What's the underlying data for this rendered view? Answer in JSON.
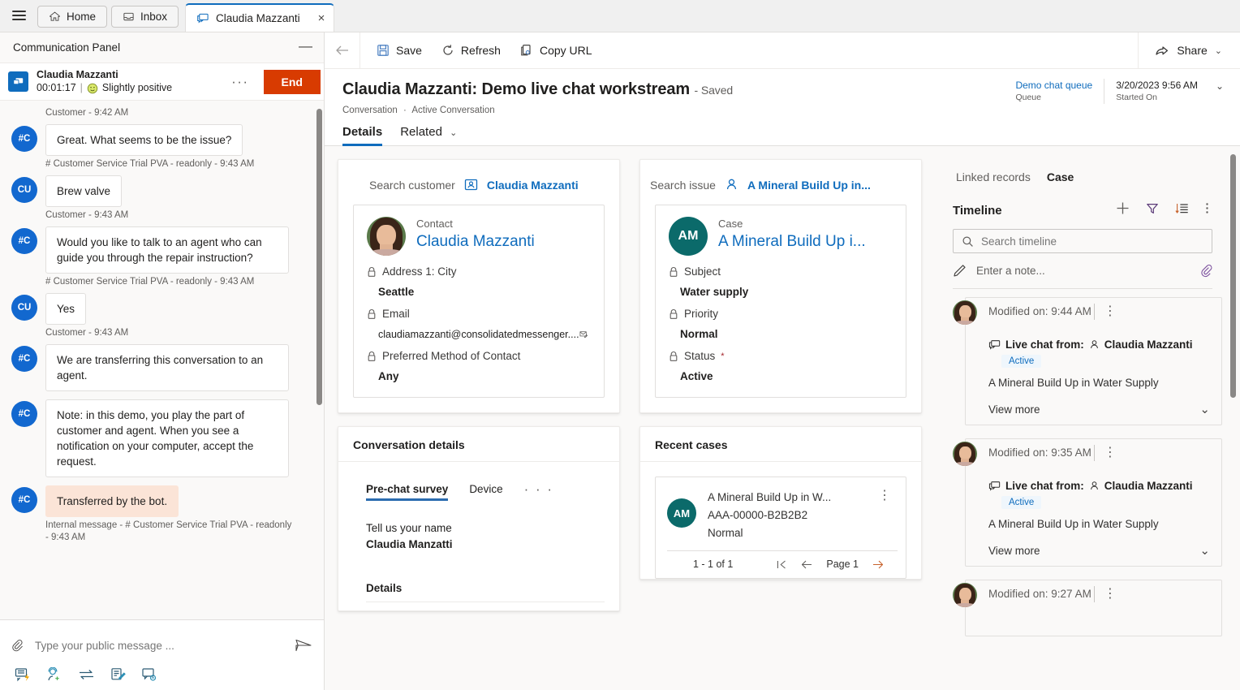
{
  "tabstrip": {
    "menu_icon": "hamburger-icon",
    "tabs": [
      {
        "label": "Home",
        "icon": "home-icon"
      },
      {
        "label": "Inbox",
        "icon": "inbox-icon"
      }
    ],
    "active_tab": {
      "label": "Claudia Mazzanti",
      "icon": "chat-icon",
      "close": "×"
    }
  },
  "communication_panel": {
    "title": "Communication Panel",
    "minimize": "—",
    "conversation": {
      "name": "Claudia Mazzanti",
      "timer": "00:01:17",
      "separator": "|",
      "sentiment": "Slightly positive",
      "sentiment_icon": "smiley-icon",
      "more": "···",
      "end_label": "End"
    },
    "messages": [
      {
        "type": "stamp",
        "text": "Customer - 9:42 AM"
      },
      {
        "type": "msg",
        "initials": "#C",
        "text": "Great. What seems to be the issue?",
        "stamp": "# Customer Service Trial PVA - readonly - 9:43 AM",
        "variant": "normal"
      },
      {
        "type": "msg",
        "initials": "CU",
        "text": "Brew valve",
        "stamp": "Customer - 9:43 AM",
        "variant": "normal"
      },
      {
        "type": "msg",
        "initials": "#C",
        "text": "Would you like to talk to an agent who can guide you through the repair instruction?",
        "stamp": "# Customer Service Trial PVA - readonly - 9:43 AM",
        "variant": "normal"
      },
      {
        "type": "msg",
        "initials": "CU",
        "text": "Yes",
        "stamp": "Customer - 9:43 AM",
        "variant": "normal"
      },
      {
        "type": "msg",
        "initials": "#C",
        "text": "We are transferring this conversation to an agent.",
        "stamp": "",
        "variant": "normal"
      },
      {
        "type": "msg",
        "initials": "#C",
        "text": "Note: in this demo, you play the part of customer and agent. When you see a notification on your computer, accept the request.",
        "stamp": "",
        "variant": "normal"
      },
      {
        "type": "msg",
        "initials": "#C",
        "text": "Transferred by the bot.",
        "stamp": "Internal message - # Customer Service Trial PVA - readonly - 9:43 AM",
        "variant": "internal"
      }
    ],
    "composer": {
      "attach_icon": "paperclip-icon",
      "placeholder": "Type your public message ...",
      "send_icon": "send-icon"
    },
    "tools": [
      {
        "icon": "quick-replies-icon"
      },
      {
        "icon": "consult-agent-icon"
      },
      {
        "icon": "transfer-icon"
      },
      {
        "icon": "notes-icon"
      },
      {
        "icon": "linked-conversation-icon"
      }
    ]
  },
  "command_bar": {
    "back_icon": "back-arrow-icon",
    "commands": [
      {
        "label": "Save",
        "icon": "save-icon"
      },
      {
        "label": "Refresh",
        "icon": "refresh-icon"
      },
      {
        "label": "Copy URL",
        "icon": "copy-url-icon"
      }
    ],
    "share": {
      "label": "Share",
      "icon": "share-icon",
      "chevron": "⌄"
    }
  },
  "record_header": {
    "title": "Claudia Mazzanti: Demo live chat workstream",
    "saved": "- Saved",
    "breadcrumb_entity": "Conversation",
    "breadcrumb_sep": "·",
    "breadcrumb_view": "Active Conversation",
    "queue_value": "Demo chat queue",
    "queue_label": "Queue",
    "started_value": "3/20/2023 9:56 AM",
    "started_label": "Started On",
    "expand_chevron": "⌄"
  },
  "form_tabs": [
    {
      "label": "Details",
      "selected": true
    },
    {
      "label": "Related",
      "selected": false,
      "chevron": "⌄"
    }
  ],
  "customer_section": {
    "search_label": "Search customer",
    "search_value": "Claudia Mazzanti",
    "search_icon": "contact-card-icon",
    "card": {
      "type": "Contact",
      "name": "Claudia Mazzanti",
      "avatar": "contact-photo",
      "fields": [
        {
          "label": "Address 1: City",
          "value": "Seattle",
          "lock": "lock-icon",
          "trailing_icon": ""
        },
        {
          "label": "Email",
          "value": "claudiamazzanti@consolidatedmessenger....",
          "lock": "lock-icon",
          "trailing_icon": "email-icon",
          "small": true
        },
        {
          "label": "Preferred Method of Contact",
          "value": "Any",
          "lock": "lock-icon",
          "trailing_icon": ""
        }
      ]
    }
  },
  "issue_section": {
    "search_label": "Search issue",
    "search_value": "A Mineral Build Up in...",
    "search_icon": "person-icon",
    "card": {
      "type": "Case",
      "name": "A Mineral Build Up i...",
      "initials": "AM",
      "avatar_color": "#0b6a6a",
      "fields": [
        {
          "label": "Subject",
          "value": "Water supply",
          "lock": "lock-icon",
          "required": false
        },
        {
          "label": "Priority",
          "value": "Normal",
          "lock": "lock-icon",
          "required": false
        },
        {
          "label": "Status",
          "value": "Active",
          "lock": "lock-icon",
          "required": true,
          "required_mark": "*"
        }
      ]
    }
  },
  "conversation_details": {
    "title": "Conversation details",
    "tabs": [
      {
        "label": "Pre-chat survey",
        "selected": true
      },
      {
        "label": "Device",
        "selected": false
      },
      {
        "label": "· · ·",
        "selected": false,
        "is_dots": true
      }
    ],
    "survey_question": "Tell us your name",
    "survey_answer": "Claudia Manzatti",
    "details_heading": "Details"
  },
  "recent_cases": {
    "title": "Recent cases",
    "items": [
      {
        "initials": "AM",
        "title": "A Mineral Build Up in W...",
        "number": "AAA-00000-B2B2B2",
        "priority": "Normal",
        "more": "⋮"
      }
    ],
    "pager": {
      "count": "1 - 1 of 1",
      "first_icon": "first-page-icon",
      "prev_icon": "prev-page-icon",
      "page_label": "Page 1",
      "next_icon": "next-page-icon"
    }
  },
  "linked_records": {
    "label": "Linked records",
    "value": "Case"
  },
  "timeline": {
    "title": "Timeline",
    "actions": [
      {
        "icon": "plus-icon"
      },
      {
        "icon": "filter-icon"
      },
      {
        "icon": "sort-icon"
      },
      {
        "icon": "more-vertical-icon"
      }
    ],
    "search_placeholder": "Search timeline",
    "search_icon": "search-icon",
    "note_placeholder": "Enter a note...",
    "note_icon": "pencil-icon",
    "note_attach_icon": "paperclip-icon",
    "entries": [
      {
        "modified": "Modified on: 9:44 AM",
        "more": "⋮",
        "from_label": "Live chat from:",
        "from_name": "Claudia Mazzanti",
        "chat_icon": "chat-icon",
        "person_icon": "person-icon",
        "badge": "Active",
        "description": "A Mineral Build Up in Water Supply",
        "view_more": "View more",
        "chevron": "⌄"
      },
      {
        "modified": "Modified on: 9:35 AM",
        "more": "⋮",
        "from_label": "Live chat from:",
        "from_name": "Claudia Mazzanti",
        "chat_icon": "chat-icon",
        "person_icon": "person-icon",
        "badge": "Active",
        "description": "A Mineral Build Up in Water Supply",
        "view_more": "View more",
        "chevron": "⌄"
      },
      {
        "modified": "Modified on: 9:27 AM",
        "more": "⋮",
        "from_label": "",
        "from_name": "",
        "badge": "",
        "description": "",
        "view_more": "",
        "chevron": ""
      }
    ]
  },
  "colors": {
    "accent": "#0f6cbd",
    "end_button": "#d83b01",
    "case_avatar": "#0b6a6a",
    "internal_message": "#fbe4d7",
    "badge_bg": "#eff6fc"
  }
}
